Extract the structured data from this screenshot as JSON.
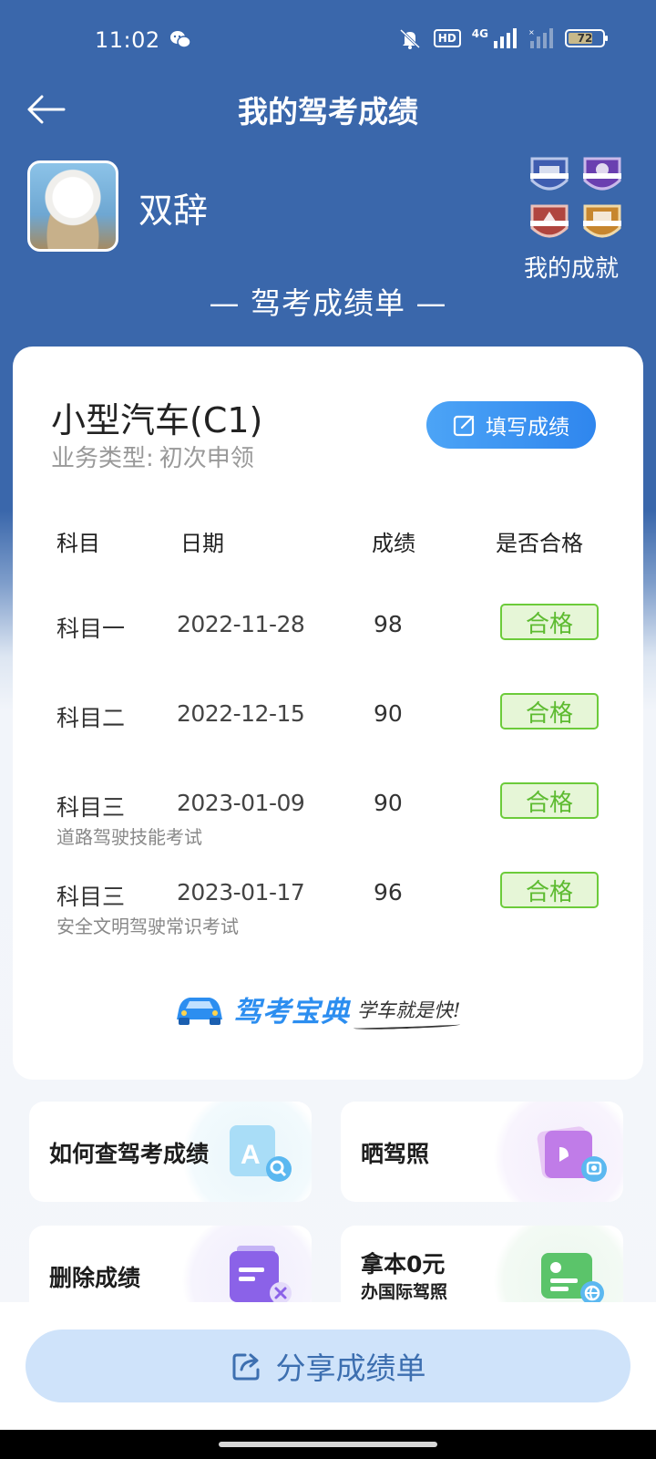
{
  "status_bar": {
    "time": "11:02",
    "network": "4G",
    "hd": "HD",
    "battery": "72",
    "battery_level": 0.72
  },
  "header": {
    "title": "我的驾考成绩"
  },
  "profile": {
    "username": "双辞",
    "achievements_label": "我的成就"
  },
  "section_title": "— 驾考成绩单 —",
  "card": {
    "license_type": "小型汽车(C1)",
    "biz_label": "业务类型:",
    "biz_value": "初次申领",
    "fill_button": "填写成绩",
    "columns": [
      "科目",
      "日期",
      "成绩",
      "是否合格"
    ],
    "rows": [
      {
        "subject": "科目一",
        "date": "2022-11-28",
        "score": "98",
        "result": "合格",
        "note": ""
      },
      {
        "subject": "科目二",
        "date": "2022-12-15",
        "score": "90",
        "result": "合格",
        "note": ""
      },
      {
        "subject": "科目三",
        "date": "2023-01-09",
        "score": "90",
        "result": "合格",
        "note": "道路驾驶技能考试"
      },
      {
        "subject": "科目三",
        "date": "2023-01-17",
        "score": "96",
        "result": "合格",
        "note": "安全文明驾驶常识考试"
      }
    ],
    "brand_name": "驾考宝典",
    "brand_slogan": "学车就是快!"
  },
  "tiles": [
    {
      "label": "如何查驾考成绩",
      "sub": "",
      "icon": "search-doc-icon"
    },
    {
      "label": "晒驾照",
      "sub": "",
      "icon": "photo-icon"
    },
    {
      "label": "删除成绩",
      "sub": "",
      "icon": "delete-doc-icon"
    },
    {
      "label": "拿本0元",
      "sub": "办国际驾照",
      "icon": "id-card-globe-icon"
    }
  ],
  "share_button": "分享成绩单",
  "colors": {
    "header_bg": "#3A67AB",
    "accent": "#2F86EE",
    "pass_green": "#5DBB30",
    "share_bg": "#CFE3FA"
  }
}
